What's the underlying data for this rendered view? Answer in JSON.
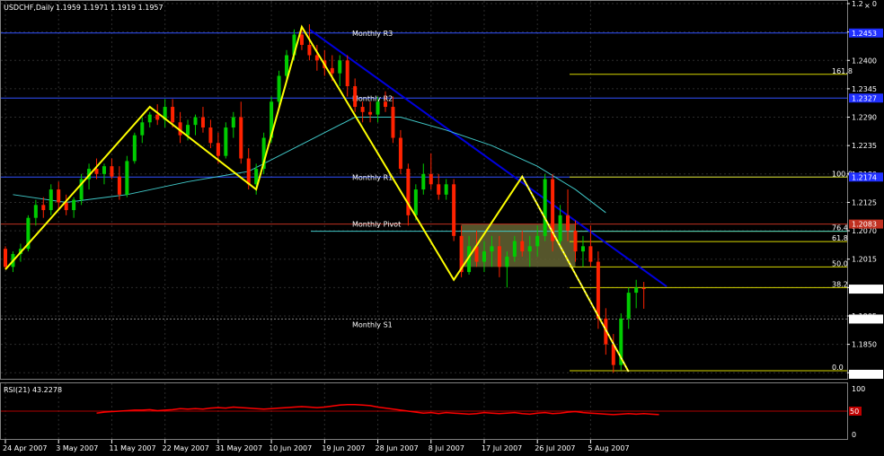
{
  "header": {
    "symbol_label": "USDCHF,Daily",
    "ohlc_text": "1.1959 1.1971 1.1919 1.1957"
  },
  "rsi_panel": {
    "label": "RSI(21) 43.2278",
    "level_label": "50",
    "axis_max": "100",
    "axis_min": "0"
  },
  "colors": {
    "background": "#000000",
    "grid": "#2c2c2c",
    "bull_body": "#00cc00",
    "bear_body": "#ff2200",
    "zigzag": "#ffff00",
    "ma": "#40c8c8",
    "trendline": "#0000dd",
    "pivot_line": "#3050ff",
    "monthly_pivot": "#c03020",
    "rsi_line": "#ff0000",
    "fib": "#d8d800",
    "box_fill": "#646432"
  },
  "chart_data": {
    "type": "candlestick",
    "symbol": "USDCHF",
    "timeframe": "Daily",
    "x_labels": [
      "24 Apr 2007",
      "3 May 2007",
      "11 May 2007",
      "22 May 2007",
      "31 May 2007",
      "10 Jun 2007",
      "19 Jun 2007",
      "28 Jun 2007",
      "8 Jul 2007",
      "17 Jul 2007",
      "26 Jul 2007",
      "5 Aug 2007"
    ],
    "y_ticks": [
      "1.2510",
      "1.2455",
      "1.2400",
      "1.2345",
      "1.2290",
      "1.2235",
      "1.2180",
      "1.2125",
      "1.2070",
      "1.2015",
      "1.1960",
      "1.1905",
      "1.1850",
      "1.1795"
    ],
    "ylim": [
      1.1785,
      1.251
    ],
    "price_tags": [
      {
        "value": 1.2453,
        "label": "1.2453",
        "color": "#2030ff"
      },
      {
        "value": 1.2327,
        "label": "1.2327",
        "color": "#2030ff"
      },
      {
        "value": 1.2174,
        "label": "1.2174",
        "color": "#2030ff"
      },
      {
        "value": 1.2083,
        "label": "1.2083",
        "color": "#c03020"
      },
      {
        "value": 1.1957,
        "label": "1.1957",
        "color": "#ffffff"
      },
      {
        "value": 1.1899,
        "label": "1.1899",
        "color": "#ffffff"
      },
      {
        "value": 1.1792,
        "label": "1.1792",
        "color": "#ffffff"
      }
    ],
    "pivots": [
      {
        "name": "Monthly R3",
        "value": 1.2453,
        "color": "#3050ff"
      },
      {
        "name": "Monthly R2",
        "value": 1.2327,
        "color": "#3050ff"
      },
      {
        "name": "Monthly R1",
        "value": 1.2174,
        "color": "#3050ff"
      },
      {
        "name": "Monthly Pivot",
        "value": 1.2083,
        "color": "#c03020"
      },
      {
        "name": "Monthly S1",
        "value": 1.1899,
        "color": "#808080"
      }
    ],
    "fib_levels": [
      {
        "label": "161.8",
        "value": 1.2373
      },
      {
        "label": "100.0",
        "value": 1.2174
      },
      {
        "label": "76.4",
        "value": 1.2069
      },
      {
        "label": "61.8",
        "value": 1.2049
      },
      {
        "label": "50.0",
        "value": 1.2
      },
      {
        "label": "38.2",
        "value": 1.196
      },
      {
        "label": "0.0",
        "value": 1.1799
      }
    ],
    "candles": [
      [
        1.2035,
        1.204,
        1.1995,
        1.2
      ],
      [
        1.2,
        1.203,
        1.199,
        1.2025
      ],
      [
        1.2025,
        1.2045,
        1.201,
        1.2035
      ],
      [
        1.2035,
        1.21,
        1.203,
        1.2095
      ],
      [
        1.2095,
        1.213,
        1.208,
        1.212
      ],
      [
        1.212,
        1.2135,
        1.2095,
        1.211
      ],
      [
        1.211,
        1.216,
        1.21,
        1.215
      ],
      [
        1.215,
        1.2165,
        1.211,
        1.2125
      ],
      [
        1.2125,
        1.214,
        1.21,
        1.211
      ],
      [
        1.211,
        1.2135,
        1.2095,
        1.213
      ],
      [
        1.213,
        1.218,
        1.212,
        1.217
      ],
      [
        1.217,
        1.22,
        1.215,
        1.219
      ],
      [
        1.219,
        1.221,
        1.217,
        1.218
      ],
      [
        1.218,
        1.22,
        1.216,
        1.2195
      ],
      [
        1.2195,
        1.221,
        1.217,
        1.2175
      ],
      [
        1.2175,
        1.2195,
        1.213,
        1.214
      ],
      [
        1.214,
        1.2215,
        1.2135,
        1.2205
      ],
      [
        1.2205,
        1.226,
        1.22,
        1.2255
      ],
      [
        1.2255,
        1.229,
        1.224,
        1.228
      ],
      [
        1.228,
        1.23,
        1.227,
        1.2295
      ],
      [
        1.2295,
        1.2315,
        1.2275,
        1.2285
      ],
      [
        1.2285,
        1.2325,
        1.227,
        1.231
      ],
      [
        1.231,
        1.2325,
        1.227,
        1.228
      ],
      [
        1.228,
        1.23,
        1.224,
        1.2255
      ],
      [
        1.2255,
        1.2285,
        1.2245,
        1.2275
      ],
      [
        1.2275,
        1.2295,
        1.2255,
        1.229
      ],
      [
        1.229,
        1.231,
        1.226,
        1.227
      ],
      [
        1.227,
        1.2285,
        1.223,
        1.224
      ],
      [
        1.224,
        1.226,
        1.22,
        1.2215
      ],
      [
        1.2215,
        1.228,
        1.221,
        1.227
      ],
      [
        1.227,
        1.23,
        1.225,
        1.229
      ],
      [
        1.229,
        1.232,
        1.22,
        1.221
      ],
      [
        1.221,
        1.223,
        1.215,
        1.216
      ],
      [
        1.216,
        1.22,
        1.214,
        1.219
      ],
      [
        1.219,
        1.226,
        1.218,
        1.225
      ],
      [
        1.225,
        1.233,
        1.224,
        1.232
      ],
      [
        1.232,
        1.238,
        1.231,
        1.237
      ],
      [
        1.237,
        1.242,
        1.236,
        1.241
      ],
      [
        1.241,
        1.246,
        1.24,
        1.245
      ],
      [
        1.245,
        1.2465,
        1.242,
        1.243
      ],
      [
        1.243,
        1.247,
        1.24,
        1.241
      ],
      [
        1.241,
        1.243,
        1.238,
        1.24
      ],
      [
        1.24,
        1.242,
        1.237,
        1.2385
      ],
      [
        1.2385,
        1.241,
        1.236,
        1.2375
      ],
      [
        1.2375,
        1.241,
        1.235,
        1.24
      ],
      [
        1.24,
        1.241,
        1.233,
        1.235
      ],
      [
        1.235,
        1.2365,
        1.23,
        1.231
      ],
      [
        1.231,
        1.232,
        1.228,
        1.23
      ],
      [
        1.23,
        1.232,
        1.228,
        1.2295
      ],
      [
        1.2295,
        1.233,
        1.228,
        1.232
      ],
      [
        1.232,
        1.234,
        1.23,
        1.231
      ],
      [
        1.231,
        1.233,
        1.224,
        1.225
      ],
      [
        1.225,
        1.2265,
        1.218,
        1.219
      ],
      [
        1.219,
        1.22,
        1.208,
        1.21
      ],
      [
        1.21,
        1.216,
        1.209,
        1.215
      ],
      [
        1.215,
        1.22,
        1.214,
        1.218
      ],
      [
        1.218,
        1.222,
        1.215,
        1.216
      ],
      [
        1.216,
        1.218,
        1.213,
        1.214
      ],
      [
        1.214,
        1.217,
        1.213,
        1.216
      ],
      [
        1.216,
        1.217,
        1.205,
        1.206
      ],
      [
        1.206,
        1.208,
        1.198,
        1.199
      ],
      [
        1.199,
        1.206,
        1.1985,
        1.204
      ],
      [
        1.204,
        1.207,
        1.2,
        1.201
      ],
      [
        1.201,
        1.205,
        1.199,
        1.203
      ],
      [
        1.203,
        1.206,
        1.2,
        1.204
      ],
      [
        1.204,
        1.206,
        1.198,
        1.2
      ],
      [
        1.2,
        1.203,
        1.196,
        1.202
      ],
      [
        1.202,
        1.206,
        1.201,
        1.205
      ],
      [
        1.205,
        1.207,
        1.202,
        1.203
      ],
      [
        1.203,
        1.206,
        1.2,
        1.204
      ],
      [
        1.204,
        1.208,
        1.202,
        1.206
      ],
      [
        1.206,
        1.218,
        1.205,
        1.217
      ],
      [
        1.217,
        1.218,
        1.203,
        1.205
      ],
      [
        1.205,
        1.212,
        1.204,
        1.21
      ],
      [
        1.21,
        1.215,
        1.205,
        1.207
      ],
      [
        1.207,
        1.209,
        1.201,
        1.203
      ],
      [
        1.203,
        1.206,
        1.2,
        1.204
      ],
      [
        1.204,
        1.208,
        1.2,
        1.201
      ],
      [
        1.201,
        1.203,
        1.188,
        1.19
      ],
      [
        1.19,
        1.192,
        1.183,
        1.185
      ],
      [
        1.185,
        1.187,
        1.1795,
        1.181
      ],
      [
        1.181,
        1.191,
        1.18,
        1.19
      ],
      [
        1.19,
        1.196,
        1.188,
        1.195
      ],
      [
        1.195,
        1.1975,
        1.192,
        1.196
      ],
      [
        1.1959,
        1.1971,
        1.1919,
        1.1957
      ]
    ],
    "ma_points": [
      [
        1,
        1.214
      ],
      [
        8,
        1.2125
      ],
      [
        16,
        1.214
      ],
      [
        24,
        1.2165
      ],
      [
        32,
        1.2185
      ],
      [
        40,
        1.2245
      ],
      [
        46,
        1.229
      ],
      [
        52,
        1.229
      ],
      [
        58,
        1.2265
      ],
      [
        64,
        1.2235
      ],
      [
        70,
        1.2195
      ],
      [
        75,
        1.215
      ],
      [
        79,
        1.2105
      ]
    ],
    "zigzag": [
      [
        0,
        1.1995
      ],
      [
        19,
        1.231
      ],
      [
        33,
        1.215
      ],
      [
        39,
        1.2465
      ],
      [
        59,
        1.1975
      ],
      [
        68,
        1.2175
      ],
      [
        82,
        1.1797
      ]
    ],
    "retracement_dotted": [
      [
        68,
        1.2175
      ],
      [
        82,
        1.1797
      ]
    ],
    "trendline": [
      [
        40,
        1.246
      ],
      [
        87,
        1.1962
      ]
    ],
    "consolidation_box": {
      "from_index": 60,
      "to_index": 75,
      "top": 1.2083,
      "bottom": 1.2
    },
    "rsi": {
      "ylim": [
        0,
        100
      ],
      "level": 50,
      "last_value": 43.2278,
      "points": [
        46,
        48,
        49,
        50,
        51,
        52,
        52,
        53,
        51,
        52,
        53,
        55,
        54,
        55,
        54,
        56,
        57,
        56,
        58,
        57,
        56,
        55,
        54,
        55,
        56,
        57,
        58,
        59,
        58,
        57,
        58,
        60,
        62,
        63,
        63,
        62,
        61,
        58,
        56,
        54,
        52,
        50,
        48,
        46,
        47,
        45,
        47,
        46,
        45,
        44,
        45,
        47,
        46,
        45,
        46,
        47,
        45,
        44,
        46,
        47,
        45,
        46,
        48,
        49,
        47,
        46,
        45,
        44,
        43,
        44,
        45,
        44,
        45,
        44,
        43
      ]
    }
  }
}
